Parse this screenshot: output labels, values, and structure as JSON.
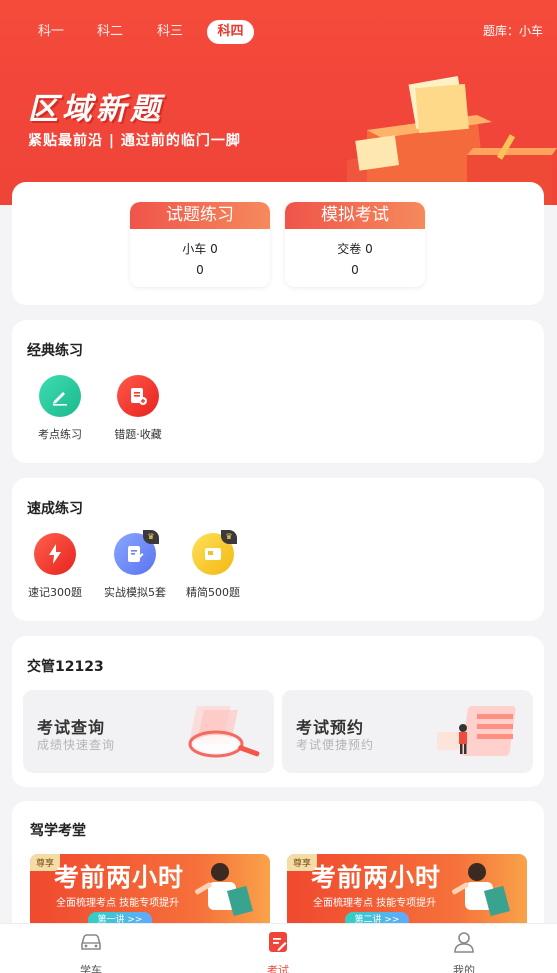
{
  "header": {
    "tabs": [
      {
        "label": "科一"
      },
      {
        "label": "科二"
      },
      {
        "label": "科三"
      },
      {
        "label": "科四"
      }
    ],
    "active_tab": "科四",
    "question_bank": "题库：小车",
    "banner_title": "区域新题",
    "banner_subtitle": "紧贴最前沿 | 通过前的临门一脚"
  },
  "stats": {
    "practice": {
      "title": "试题练习",
      "line1": "小车  0",
      "line2": "0"
    },
    "exam": {
      "title": "模拟考试",
      "line1": "交卷  0",
      "line2": "0"
    }
  },
  "classic": {
    "title": "经典练习",
    "items": [
      {
        "label": "考点练习",
        "icon": "pencil-icon"
      },
      {
        "label": "错题·收藏",
        "icon": "bookmark-icon"
      }
    ]
  },
  "quick": {
    "title": "速成练习",
    "items": [
      {
        "label": "速记300题",
        "icon": "lightning-icon"
      },
      {
        "label": "实战模拟5套",
        "icon": "edit-doc-icon"
      },
      {
        "label": "精简500题",
        "icon": "card-icon"
      }
    ]
  },
  "traffic": {
    "title": "交管12123",
    "services": [
      {
        "title": "考试查询",
        "subtitle": "成绩快速查询"
      },
      {
        "title": "考试预约",
        "subtitle": "考试便捷预约"
      }
    ]
  },
  "classroom": {
    "title": "驾学考堂",
    "courses": [
      {
        "tag": "尊享",
        "title": "考前两小时",
        "subtitle": "全面梳理考点  技能专项提升",
        "pill": "第一讲 >>"
      },
      {
        "tag": "尊享",
        "title": "考前两小时",
        "subtitle": "全面梳理考点  技能专项提升",
        "pill": "第二讲 >>"
      }
    ]
  },
  "bottom_nav": [
    {
      "label": "学车",
      "icon": "car-icon"
    },
    {
      "label": "考试",
      "icon": "exam-icon"
    },
    {
      "label": "我的",
      "icon": "user-icon"
    }
  ],
  "colors": {
    "brand": "#ef4438",
    "accent_orange": "#f6703a"
  }
}
